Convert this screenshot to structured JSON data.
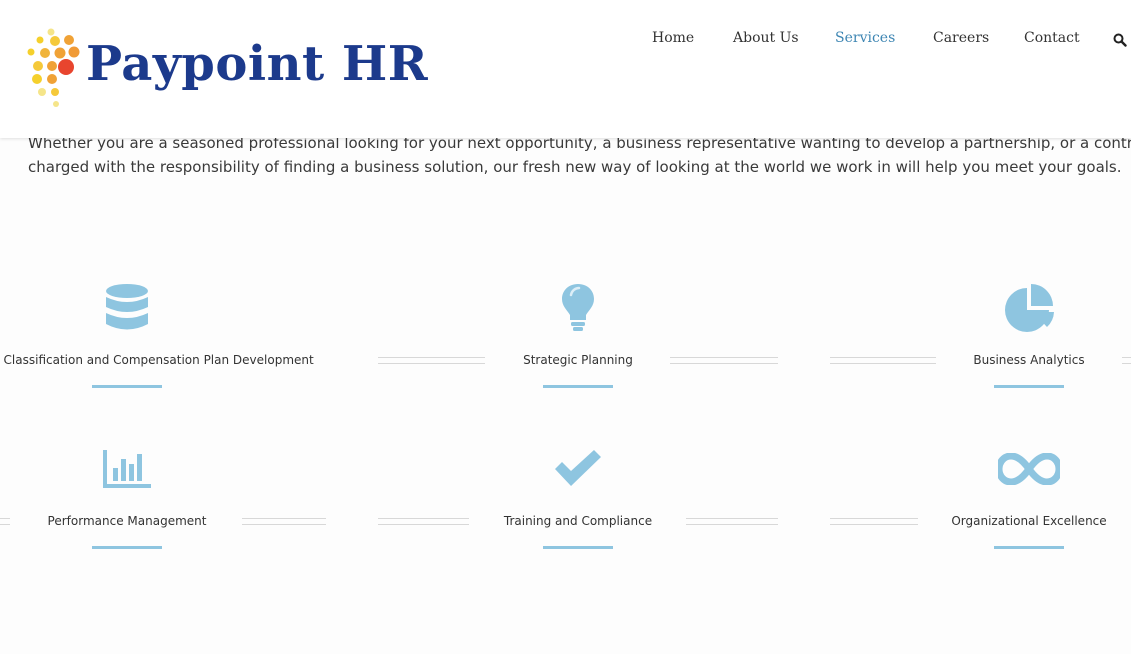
{
  "brand": {
    "name": "Paypoint HR",
    "text_color": "#1c3a8c",
    "dot_colors": [
      "#f5d02c",
      "#f0a236",
      "#e8452e"
    ]
  },
  "nav": {
    "items": [
      {
        "label": "Home"
      },
      {
        "label": "About Us"
      },
      {
        "label": "Services",
        "active": true
      },
      {
        "label": "Careers"
      },
      {
        "label": "Contact"
      }
    ],
    "search_icon": "search-icon",
    "active_color": "#3e86b3"
  },
  "intro": {
    "line1": "Whether you are a seasoned professional looking for your next opportunity, a business representative wanting to develop a partnership, or a contract officer",
    "line2": "charged with the responsibility of finding a business solution, our fresh new way of looking at the world we work in will help you meet your goals."
  },
  "services": [
    {
      "label": "Employee Classification and Compensation Plan Development",
      "icon": "database-icon"
    },
    {
      "label": "Strategic Planning",
      "icon": "lightbulb-icon"
    },
    {
      "label": "Business Analytics",
      "icon": "pie-chart-icon"
    },
    {
      "label": "Performance Management",
      "icon": "bar-chart-icon"
    },
    {
      "label": "Training and Compliance",
      "icon": "checkmark-icon"
    },
    {
      "label": "Organizational Excellence",
      "icon": "infinity-icon"
    }
  ],
  "accent_color": "#8ec5e0"
}
